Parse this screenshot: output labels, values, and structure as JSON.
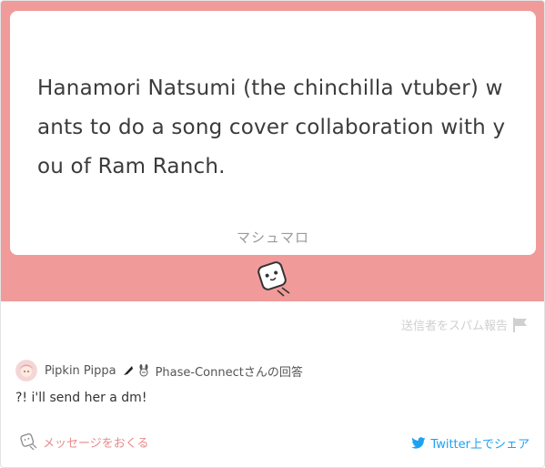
{
  "question": {
    "text": "Hanamori Natsumi (the chinchilla vtuber) wants to do a song cover collaboration with you of Ram Ranch.",
    "brand": "マシュマロ"
  },
  "report": {
    "label": "送信者をスパム報告"
  },
  "answer": {
    "author": "Pipkin Pippa",
    "group_suffix": "Phase-Connectさんの回答",
    "text": "?! i'll send her a dm!"
  },
  "footer": {
    "send_label": "メッセージをおくる",
    "share_label": "Twitter上でシェア"
  },
  "colors": {
    "accent_pink": "#f19a9a",
    "link_pink": "#e88a8a",
    "twitter_blue": "#1da1f2"
  }
}
